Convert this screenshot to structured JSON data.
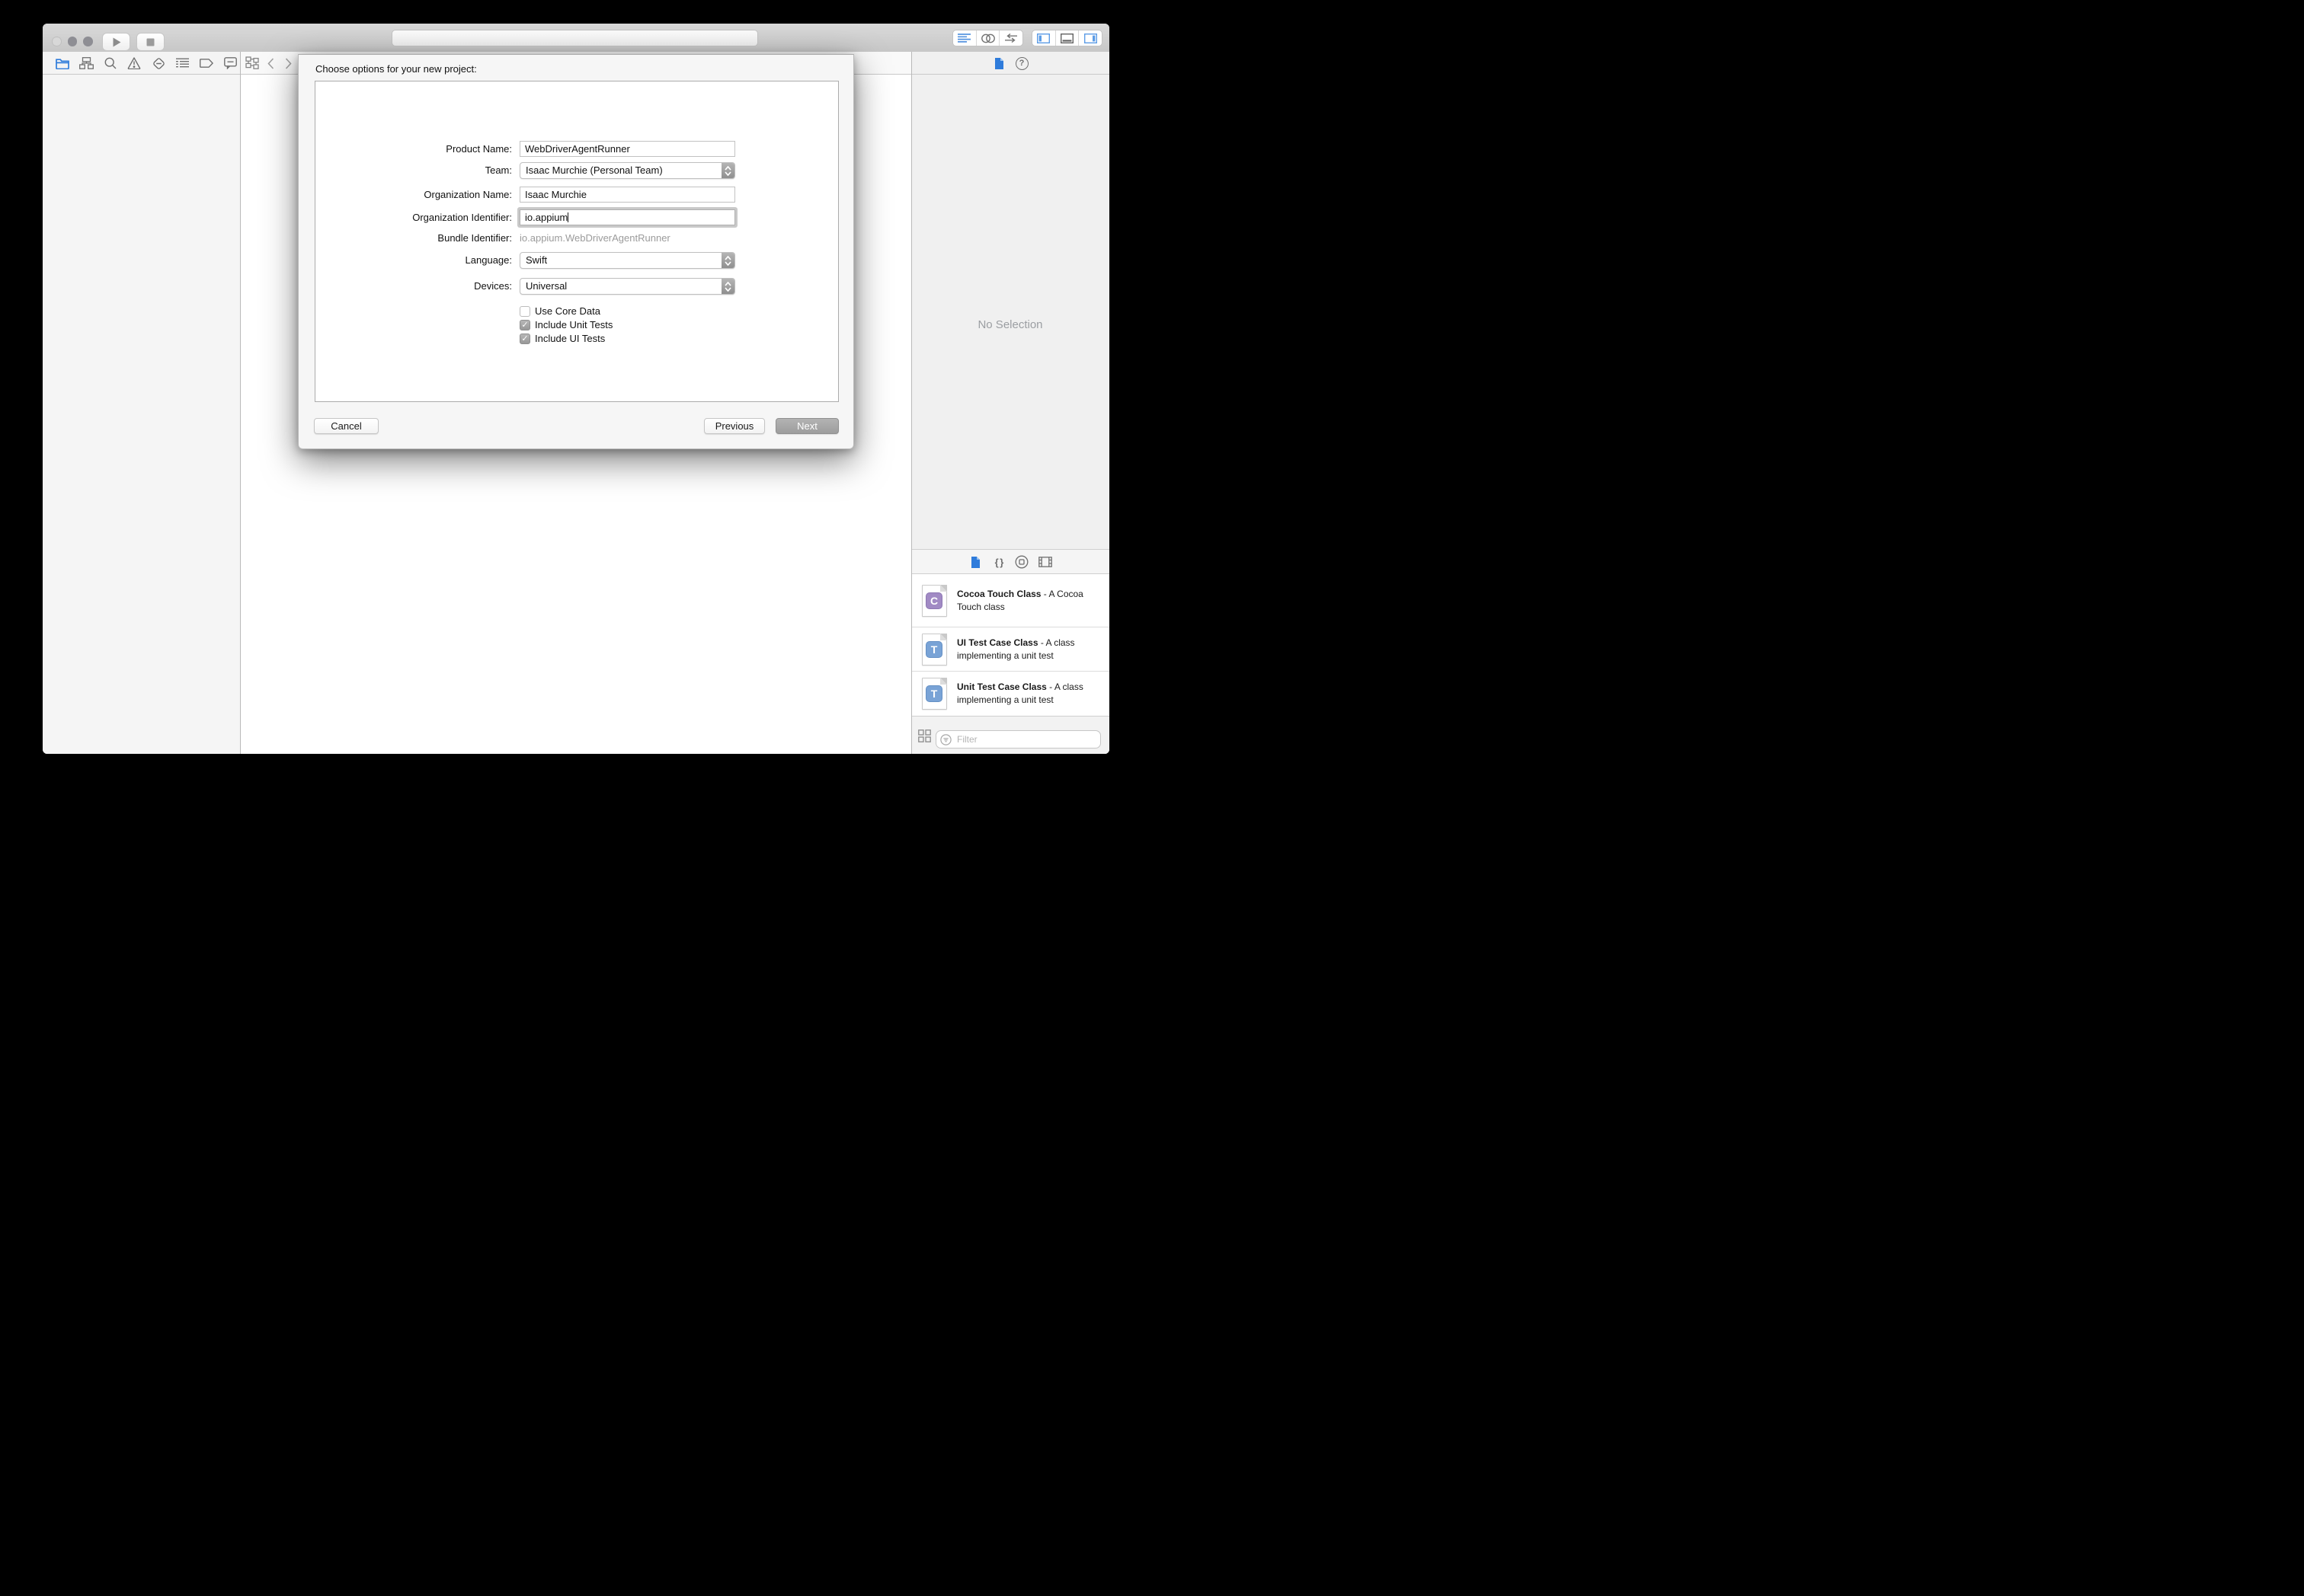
{
  "icons": {
    "help_glyph": "?",
    "braces_glyph": "{ }",
    "checkmark": "✓"
  },
  "dialog": {
    "title": "Choose options for your new project:",
    "fields": [
      {
        "label": "Product Name:",
        "value": "WebDriverAgentRunner"
      },
      {
        "label": "Team:",
        "value": "Isaac Murchie (Personal Team)"
      },
      {
        "label": "Organization Name:",
        "value": "Isaac Murchie"
      },
      {
        "label": "Organization Identifier:",
        "value": "io.appium"
      },
      {
        "label": "Bundle Identifier:",
        "value": "io.appium.WebDriverAgentRunner"
      },
      {
        "label": "Language:",
        "value": "Swift"
      },
      {
        "label": "Devices:",
        "value": "Universal"
      }
    ],
    "checkboxes": [
      {
        "label": "Use Core Data",
        "checked": false
      },
      {
        "label": "Include Unit Tests",
        "checked": true
      },
      {
        "label": "Include UI Tests",
        "checked": true
      }
    ],
    "buttons": {
      "cancel": "Cancel",
      "previous": "Previous",
      "next": "Next"
    }
  },
  "utilities": {
    "no_selection": "No Selection",
    "library": {
      "items": [
        {
          "badge": "C",
          "title": "Cocoa Touch Class",
          "sep": " - ",
          "desc": "A Cocoa Touch class"
        },
        {
          "badge": "T",
          "title": "UI Test Case Class",
          "sep": " - ",
          "desc": "A class implementing a unit test"
        },
        {
          "badge": "T",
          "title": "Unit Test Case Class",
          "sep": " - ",
          "desc": "A class implementing a unit test"
        }
      ],
      "filter_placeholder": "Filter"
    }
  },
  "colors": {
    "accent_blue": "#2f7cdb",
    "badge_purple": "#a18ac4",
    "badge_blue": "#79a3d6",
    "icon_gray": "#6f6f6f"
  }
}
